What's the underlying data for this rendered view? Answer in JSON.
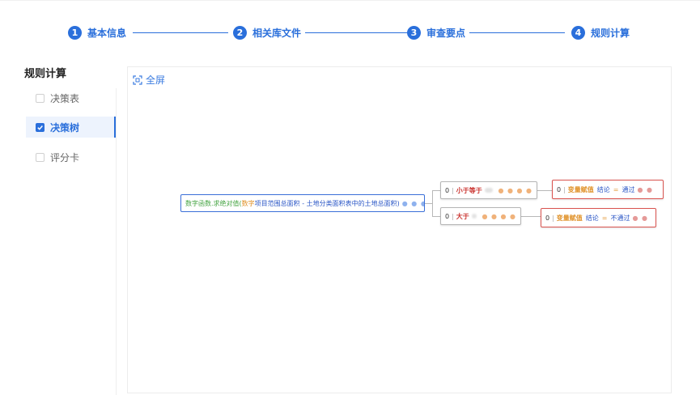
{
  "steps": [
    {
      "num": "1",
      "label": "基本信息"
    },
    {
      "num": "2",
      "label": "相关库文件"
    },
    {
      "num": "3",
      "label": "审查要点"
    },
    {
      "num": "4",
      "label": "规则计算"
    }
  ],
  "sidebar": {
    "title": "规则计算",
    "items": [
      {
        "label": "决策表",
        "checked": false
      },
      {
        "label": "决策树",
        "checked": true
      },
      {
        "label": "评分卡",
        "checked": false
      }
    ]
  },
  "canvas": {
    "fullscreen_label": "全屏"
  },
  "tree": {
    "root": {
      "func": "数字函数.求绝对值(",
      "type": "数字",
      "expr": " 项目范围总面积 - 土地分类面积表中的土地总面积",
      "close": ")",
      "dots": "● ● ●"
    },
    "branches": [
      {
        "cond": {
          "index": "0",
          "op": "小于等于",
          "dots": "● ● ● ●"
        },
        "result": {
          "index": "0",
          "var": "变量赋值",
          "field": "结论",
          "eq": "=",
          "value": "通过",
          "dots": "● ●"
        }
      },
      {
        "cond": {
          "index": "0",
          "op": "大于",
          "dots": "● ● ● ●"
        },
        "result": {
          "index": "0",
          "var": "变量赋值",
          "field": "结论",
          "eq": "=",
          "value": "不通过",
          "dots": "● ●"
        }
      }
    ]
  },
  "colors": {
    "primary": "#2a6fdb",
    "active_bg": "#edf3fd",
    "result_border": "#d9534f",
    "root_border": "#3a6fd8"
  }
}
